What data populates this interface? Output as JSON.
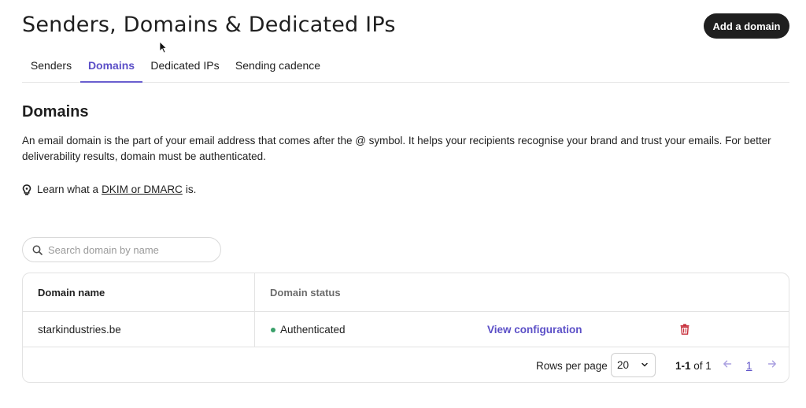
{
  "header": {
    "title": "Senders, Domains & Dedicated IPs",
    "add_button_label": "Add a domain"
  },
  "tabs": [
    {
      "label": "Senders",
      "active": false
    },
    {
      "label": "Domains",
      "active": true
    },
    {
      "label": "Dedicated IPs",
      "active": false
    },
    {
      "label": "Sending cadence",
      "active": false
    }
  ],
  "section": {
    "title": "Domains",
    "description": "An email domain is the part of your email address that comes after the @ symbol. It helps your recipients recognise your brand and trust your emails. For better deliverability results, domain must be authenticated.",
    "learn_prefix": "Learn what a",
    "learn_link": "DKIM or DMARC",
    "learn_suffix": "is."
  },
  "search": {
    "placeholder": "Search domain by name",
    "value": ""
  },
  "table": {
    "columns": [
      "Domain name",
      "Domain status"
    ],
    "rows": [
      {
        "domain": "starkindustries.be",
        "status": "Authenticated",
        "status_color": "#3aa06a",
        "action_label": "View configuration"
      }
    ]
  },
  "pagination": {
    "rows_per_page_label": "Rows per page",
    "rows_per_page_value": "20",
    "range_bold": "1-1",
    "range_rest": "of 1",
    "current_page": "1"
  },
  "colors": {
    "accent": "#5b4fc7",
    "primary_button": "#1f1f1f",
    "delete": "#c8303c",
    "success": "#3aa06a"
  },
  "icons": [
    "lightbulb-icon",
    "search-icon",
    "trash-icon",
    "chevron-down-icon",
    "arrow-left-icon",
    "arrow-right-icon",
    "mouse-cursor-icon"
  ]
}
